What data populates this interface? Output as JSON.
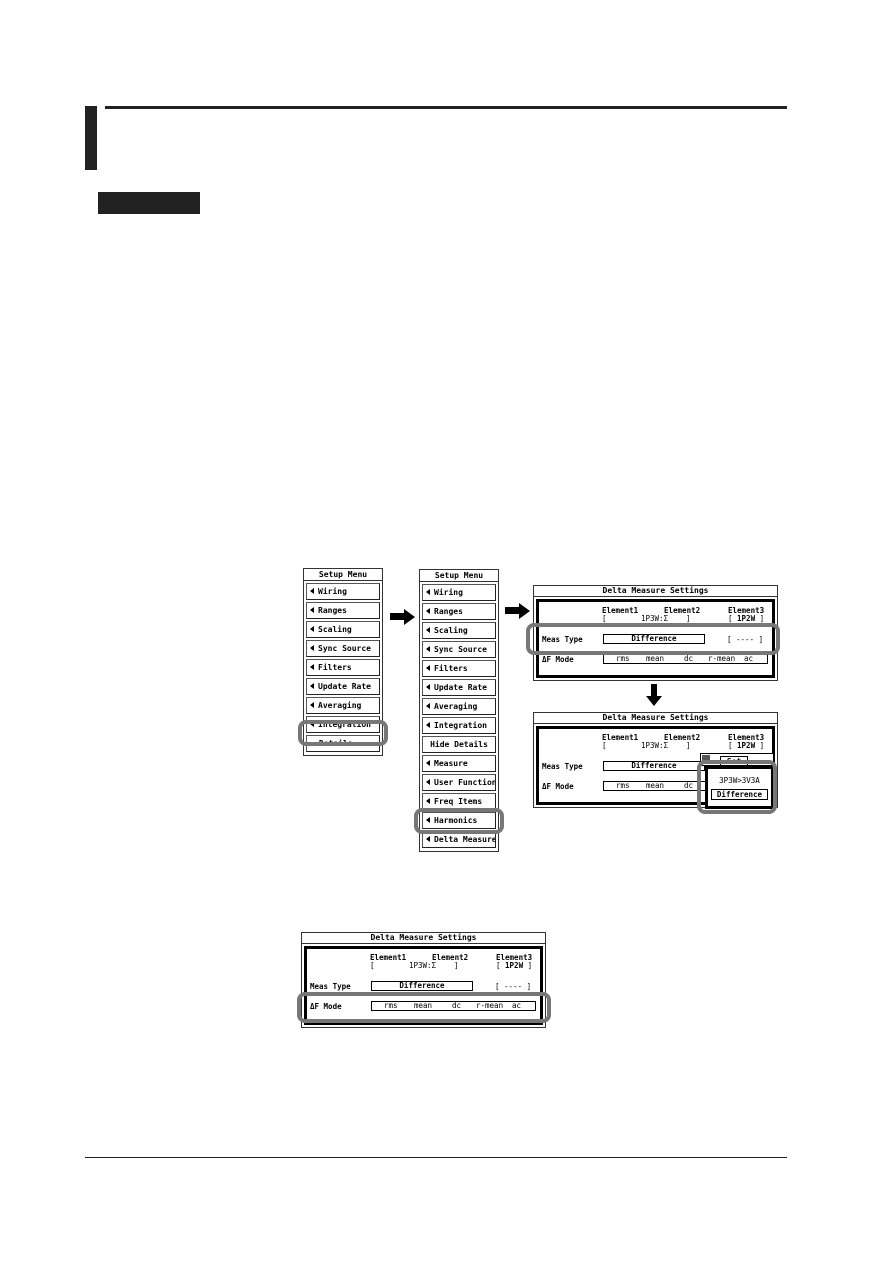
{
  "menu1": {
    "title": "Setup Menu",
    "items": [
      "Wiring",
      "Ranges",
      "Scaling",
      "Sync Source",
      "Filters",
      "Update Rate",
      "Averaging",
      "Integration"
    ],
    "details": "Details..."
  },
  "menu2": {
    "title": "Setup Menu",
    "items": [
      "Wiring",
      "Ranges",
      "Scaling",
      "Sync Source",
      "Filters",
      "Update Rate",
      "Averaging",
      "Integration"
    ],
    "hide": "Hide Details",
    "items2": [
      "Measure",
      "User Function",
      "Freq Items",
      "Harmonics",
      "Delta Measure"
    ]
  },
  "panel": {
    "title": "Delta Measure Settings",
    "el1": "Element1",
    "el2": "Element2",
    "el3": "Element3",
    "wiring12": "1P3W:Σ",
    "wiring3": "1P2W",
    "meas_type_label": "Meas Type",
    "meas_type_value": "Difference",
    "el3_value": "----",
    "df_label": "ΔF Mode",
    "modes": [
      "rms",
      "mean",
      "dc",
      "r-mean",
      "ac"
    ]
  },
  "popup": {
    "set": "Set",
    "option1": "3P3W>3V3A",
    "option2": "Difference"
  },
  "colors": {
    "highlight": "#777777",
    "text": "#000000"
  }
}
